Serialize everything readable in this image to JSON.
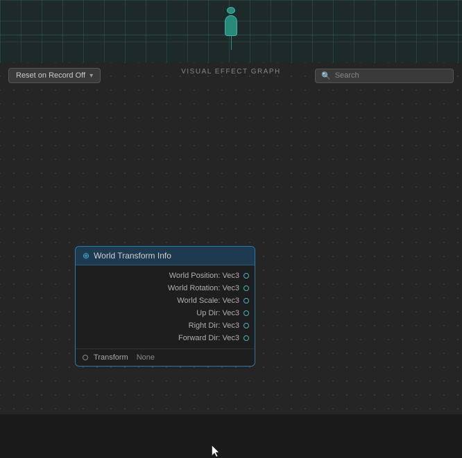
{
  "toolbar": {
    "title": "VISUAL EFFECT GRAPH",
    "icons": [
      "transform-icon",
      "reset-icon",
      "record-icon",
      "play-icon"
    ]
  },
  "header": {
    "dropdown_label": "Reset on Record Off",
    "search_placeholder": "Search"
  },
  "node": {
    "title": "World Transform Info",
    "icon": "world-icon",
    "ports": [
      {
        "label": "World Position: Vec3"
      },
      {
        "label": "World Rotation: Vec3"
      },
      {
        "label": "World Scale: Vec3"
      },
      {
        "label": "Up Dir: Vec3"
      },
      {
        "label": "Right Dir: Vec3"
      },
      {
        "label": "Forward Dir: Vec3"
      }
    ],
    "input_label": "Transform",
    "input_value": "None"
  }
}
